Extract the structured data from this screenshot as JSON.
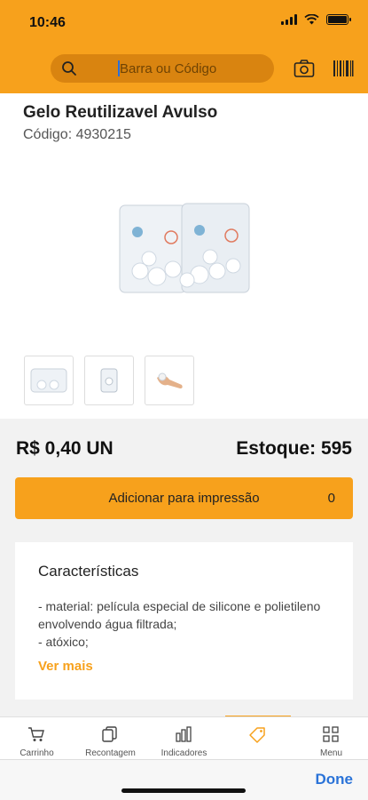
{
  "status": {
    "time": "10:46"
  },
  "search": {
    "placeholder": "Barra ou Código",
    "value": ""
  },
  "product": {
    "title": "Gelo Reutilizavel Avulso",
    "code_label": "Código: 4930215"
  },
  "price": {
    "label": "R$ 0,40 UN"
  },
  "stock": {
    "label": "Estoque: 595"
  },
  "print_button": {
    "label": "Adicionar para impressão",
    "count": "0"
  },
  "features": {
    "title": "Características",
    "text_line1": "- material: película especial de silicone e polietileno envolvendo água filtrada;",
    "text_line2": "- atóxico;",
    "more_label": "Ver mais"
  },
  "tabs": [
    {
      "label": "Carrinho",
      "icon": "cart-icon"
    },
    {
      "label": "Recontagem",
      "icon": "copy-icon"
    },
    {
      "label": "Indicadores",
      "icon": "bar-chart-icon"
    },
    {
      "label": "",
      "icon": "tag-icon",
      "active": true
    },
    {
      "label": "Menu",
      "icon": "grid-icon"
    }
  ],
  "keyboard_bar": {
    "done_label": "Done"
  },
  "colors": {
    "accent": "#f7a11c",
    "link": "#2a73d8"
  }
}
